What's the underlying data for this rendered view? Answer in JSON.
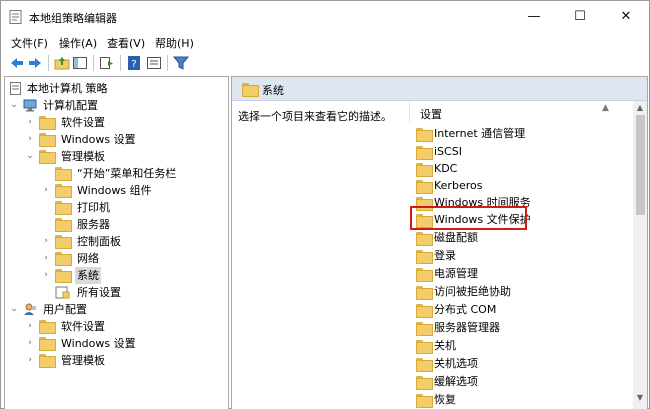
{
  "window": {
    "title": "本地组策略编辑器",
    "minimize_glyph": "—",
    "maximize_glyph": "☐",
    "close_glyph": "✕"
  },
  "menu": [
    "文件(F)",
    "操作(A)",
    "查看(V)",
    "帮助(H)"
  ],
  "toolbar": {
    "icons": [
      "back-arrow-icon",
      "forward-arrow-icon",
      "up-folder-icon",
      "show-hide-tree-icon",
      "export-list-icon",
      "help-icon",
      "properties-icon",
      "filter-icon"
    ]
  },
  "tree": {
    "root": "本地计算机 策略",
    "computer_config": "计算机配置",
    "cc_software": "软件设置",
    "cc_windows": "Windows 设置",
    "cc_admin": "管理模板",
    "start_menu": "“开始”菜单和任务栏",
    "windows_components": "Windows 组件",
    "printers": "打印机",
    "server": "服务器",
    "control_panel": "控制面板",
    "network": "网络",
    "system": "系统",
    "all_settings": "所有设置",
    "user_config": "用户配置",
    "uc_software": "软件设置",
    "uc_windows": "Windows 设置",
    "uc_admin": "管理模板"
  },
  "right": {
    "header": "系统",
    "description": "选择一个项目来查看它的描述。",
    "column": "设置",
    "items": [
      "Internet 通信管理",
      "iSCSI",
      "KDC",
      "Kerberos",
      "Windows 时间服务",
      "Windows 文件保护",
      "磁盘配额",
      "登录",
      "电源管理",
      "访问被拒绝协助",
      "分布式 COM",
      "服务器管理器",
      "关机",
      "关机选项",
      "缓解选项",
      "恢复"
    ],
    "highlighted": "Windows 文件保护"
  },
  "colors": {
    "highlight_border": "#d11a1a",
    "header_bg": "#dde6f1",
    "selected_bg": "#d9d9d9"
  }
}
